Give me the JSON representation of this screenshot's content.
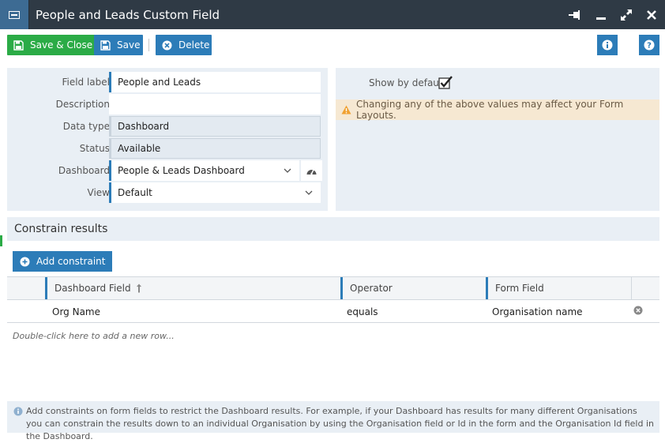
{
  "window": {
    "title": "People and Leads Custom Field",
    "icons": {
      "window": "window-icon",
      "pin": "pin-icon",
      "minimize": "minimize-icon",
      "maximize": "maximize-icon",
      "close": "close-icon"
    }
  },
  "toolbar": {
    "save_close_label": "Save & Close",
    "save_label": "Save",
    "delete_label": "Delete"
  },
  "form": {
    "field_label": {
      "label": "Field label",
      "value": "People and Leads"
    },
    "description": {
      "label": "Description",
      "value": ""
    },
    "data_type": {
      "label": "Data type",
      "value": "Dashboard"
    },
    "status": {
      "label": "Status",
      "value": "Available"
    },
    "dashboard": {
      "label": "Dashboard",
      "value": "People & Leads Dashboard"
    },
    "view": {
      "label": "View",
      "value": "Default"
    }
  },
  "right_panel": {
    "show_by_default_label": "Show by default",
    "show_by_default_checked": true,
    "warning": "Changing any of the above values may affect your Form Layouts."
  },
  "constraints": {
    "section_title": "Constrain results",
    "add_label": "Add constraint",
    "columns": [
      "Dashboard Field",
      "Operator",
      "Form Field"
    ],
    "rows": [
      {
        "dashboard_field": "Org Name",
        "operator": "equals",
        "form_field": "Organisation name"
      }
    ],
    "new_row_hint": "Double-click here to add a new row..."
  },
  "info_text": "Add constraints on form fields to restrict the Dashboard results. For example, if your Dashboard has results for many different Organisations you can constrain the results down to an individual Organisation by using the Organisation field or Id in the form and the Organisation Id field in the Dashboard.",
  "colors": {
    "titlebar": "#2f3a45",
    "accent_blue": "#2c7cb8",
    "accent_green": "#2bab46",
    "panel": "#e9eff5",
    "warning_bg": "#f6e8d2",
    "warning_icon": "#f0a030"
  }
}
